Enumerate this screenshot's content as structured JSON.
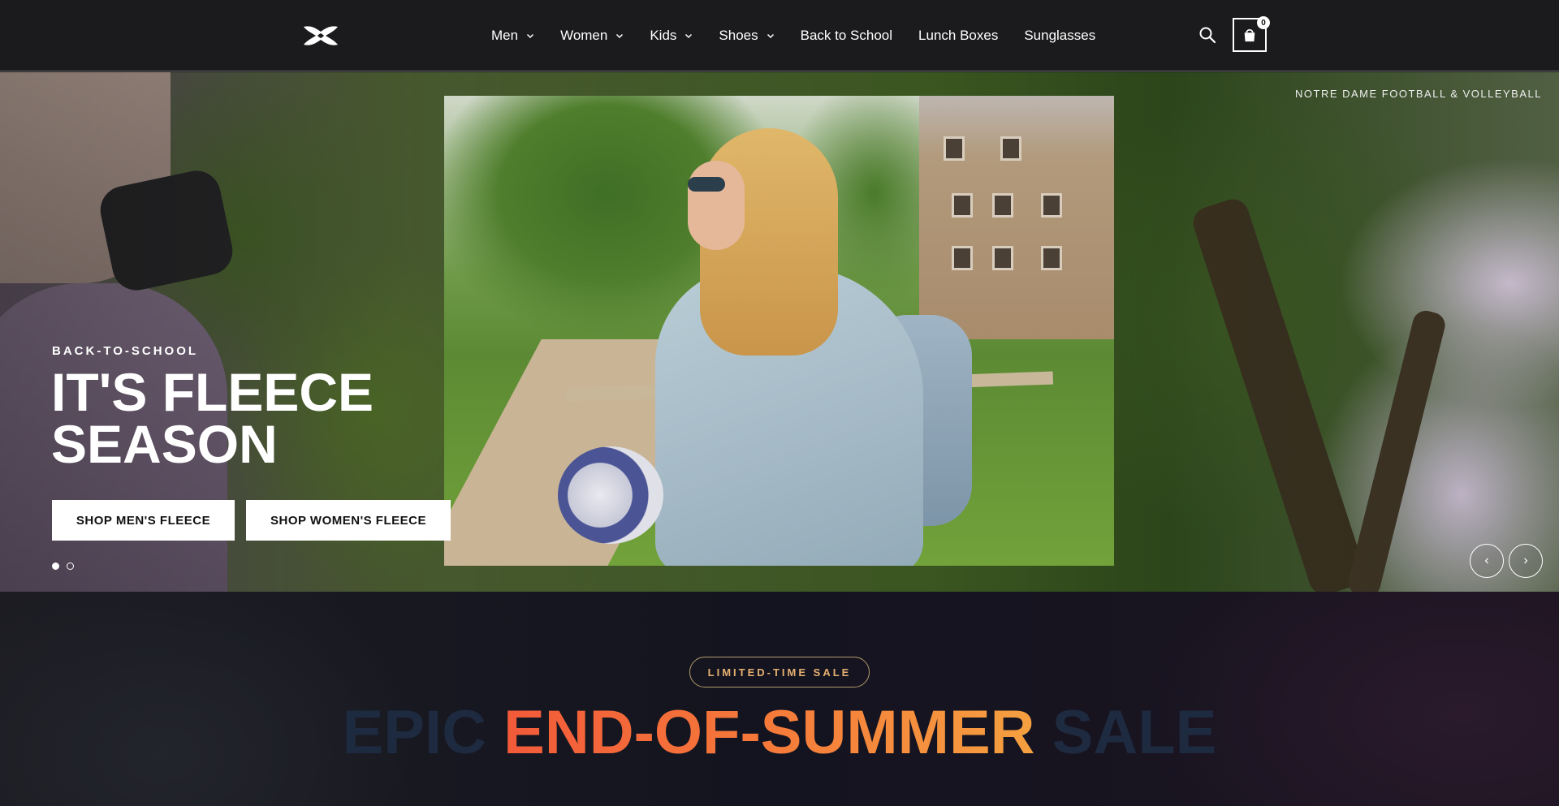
{
  "header": {
    "logo": "under-armour-logo",
    "nav": [
      {
        "label": "Men",
        "has_dropdown": true
      },
      {
        "label": "Women",
        "has_dropdown": true
      },
      {
        "label": "Kids",
        "has_dropdown": true
      },
      {
        "label": "Shoes",
        "has_dropdown": true
      },
      {
        "label": "Back to School",
        "has_dropdown": false
      },
      {
        "label": "Lunch Boxes",
        "has_dropdown": false
      },
      {
        "label": "Sunglasses",
        "has_dropdown": false
      }
    ],
    "cart_count": "0"
  },
  "hero": {
    "eyebrow": "BACK-TO-SCHOOL",
    "title": "IT'S FLEECE SEASON",
    "buttons": {
      "men": "SHOP MEN'S FLEECE",
      "women": "SHOP WOMEN'S FLEECE"
    },
    "caption": "NOTRE DAME FOOTBALL & VOLLEYBALL",
    "slides": 2,
    "active_slide": 1,
    "prev_label": "‹",
    "next_label": "›"
  },
  "sale": {
    "badge": "LIMITED-TIME SALE",
    "title_parts": [
      "EPIC",
      "END-OF-SUMMER",
      "SALE"
    ]
  },
  "colors": {
    "header_bg": "#1b1b1d",
    "sale_accent_start": "#f25a3a",
    "sale_accent_end": "#f5a040",
    "badge_text": "#e5b070"
  }
}
